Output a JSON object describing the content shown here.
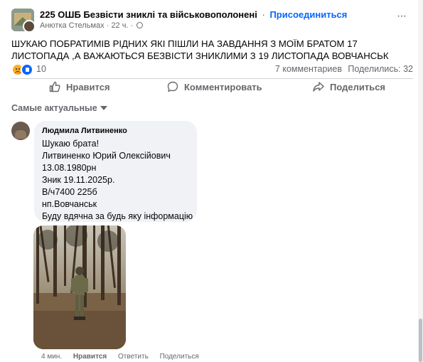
{
  "post": {
    "group_name": "225 ОШБ Безвісти зниклі та військовополонені",
    "separator": "·",
    "join_label": "Присоединиться",
    "author": "Анютка Стельмах",
    "time": "22 ч.",
    "text": "ШУКАЮ ПОБРАТИМІВ РІДНИХ ЯКІ ПІШЛИ НА ЗАВДАННЯ З МОЇМ БРАТОМ   17 ЛИСТОПАДА ,А ВАЖАЮТЬСЯ БЕЗВІСТИ ЗНИКЛИМИ З 19 ЛИСТОПАДА  ВОВЧАНСЬК",
    "reaction_count": "10",
    "reaction_icons": [
      "care-reaction-icon",
      "like-reaction-icon"
    ],
    "comments_count": "7 комментариев",
    "shares_count": "Поделились: 32",
    "more_icon": "more-options-icon",
    "close_icon": "close-icon"
  },
  "actions": {
    "like": "Нравится",
    "comment": "Комментировать",
    "share": "Поделиться"
  },
  "comments_sort": "Самые актуальные",
  "comment": {
    "author": "Людмила Литвиненко",
    "lines": [
      "Шукаю брата!",
      "Литвиненко Юрий Олексійович",
      "13.08.1980рн",
      "Зник 19.11.2025р.",
      "В/ч7400 225б",
      "нп.Вовчанськ",
      "Буду вдячна за будь яку інформацію"
    ],
    "time": "4 мин.",
    "like": "Нравится",
    "reply": "Ответить",
    "share": "Поделиться"
  },
  "colors": {
    "accent": "#0866ff",
    "secondary_text": "#65676b",
    "bubble": "#f0f2f5",
    "divider": "#ced0d4"
  }
}
